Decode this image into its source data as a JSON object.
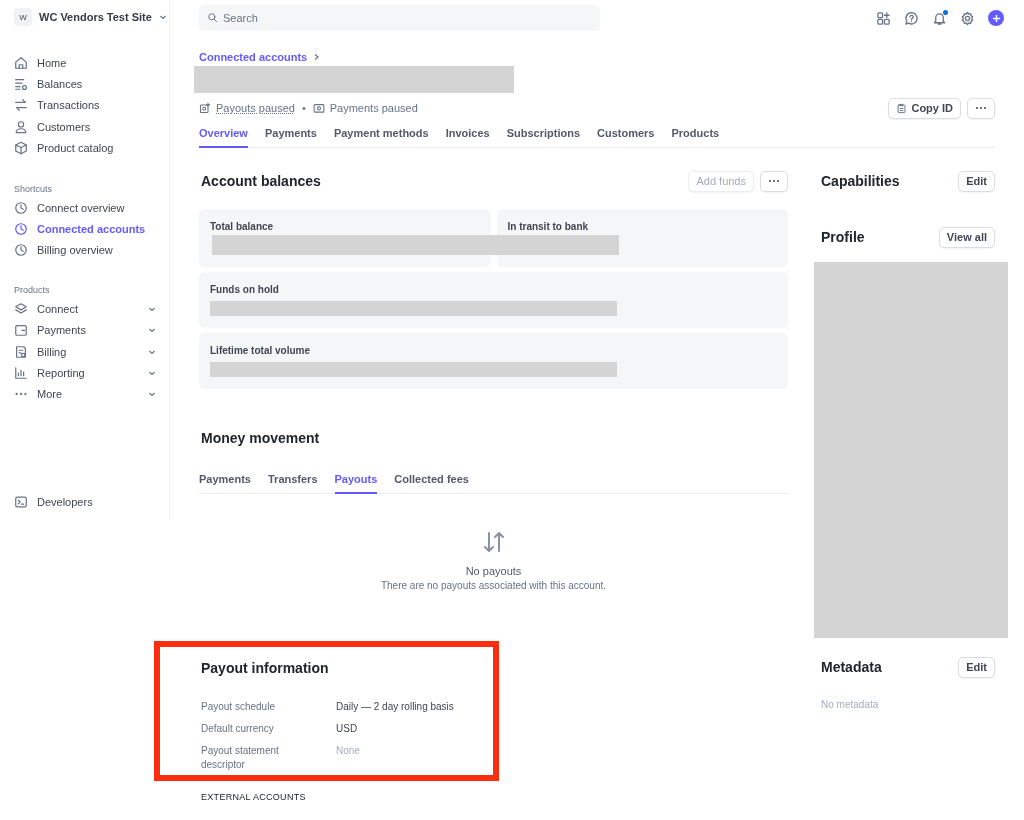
{
  "sidebar": {
    "account": {
      "initial": "W",
      "name": "WC Vendors Test Site"
    },
    "nav": [
      {
        "label": "Home"
      },
      {
        "label": "Balances"
      },
      {
        "label": "Transactions"
      },
      {
        "label": "Customers"
      },
      {
        "label": "Product catalog"
      }
    ],
    "shortcuts": {
      "title": "Shortcuts",
      "items": [
        {
          "label": "Connect overview",
          "selected": false
        },
        {
          "label": "Connected accounts",
          "selected": true
        },
        {
          "label": "Billing overview",
          "selected": false
        }
      ]
    },
    "products": {
      "title": "Products",
      "items": [
        {
          "label": "Connect"
        },
        {
          "label": "Payments"
        },
        {
          "label": "Billing"
        },
        {
          "label": "Reporting"
        },
        {
          "label": "More"
        }
      ]
    },
    "developers": {
      "label": "Developers"
    }
  },
  "search": {
    "placeholder": "Search"
  },
  "notifications": {
    "unread": true
  },
  "breadcrumb": "Connected accounts",
  "status": {
    "payouts": "Payouts paused",
    "separator": "•",
    "payments": "Payments paused"
  },
  "copy_id": "Copy ID",
  "tabs": [
    {
      "label": "Overview",
      "selected": true
    },
    {
      "label": "Payments",
      "selected": false
    },
    {
      "label": "Payment methods",
      "selected": false
    },
    {
      "label": "Invoices",
      "selected": false
    },
    {
      "label": "Subscriptions",
      "selected": false
    },
    {
      "label": "Customers",
      "selected": false
    },
    {
      "label": "Products",
      "selected": false
    }
  ],
  "account_balances": {
    "title": "Account balances",
    "add_funds": {
      "label": "Add funds",
      "disabled": true
    },
    "cards": [
      {
        "label": "Total balance"
      },
      {
        "label": "In transit to bank"
      },
      {
        "label": "Funds on hold"
      },
      {
        "label": "Lifetime total volume"
      }
    ]
  },
  "money_movement": {
    "title": "Money movement",
    "tabs": [
      {
        "label": "Payments",
        "selected": false
      },
      {
        "label": "Transfers",
        "selected": false
      },
      {
        "label": "Payouts",
        "selected": true
      },
      {
        "label": "Collected fees",
        "selected": false
      }
    ],
    "empty": {
      "title": "No payouts",
      "description": "There are no payouts associated with this account."
    }
  },
  "payout_information": {
    "title": "Payout information",
    "rows": [
      {
        "label": "Payout schedule",
        "value": "Daily — 2 day rolling basis",
        "muted": false
      },
      {
        "label": "Default currency",
        "value": "USD",
        "muted": false
      },
      {
        "label": "Payout statement descriptor",
        "value": "None",
        "muted": true
      }
    ]
  },
  "external_accounts": "EXTERNAL ACCOUNTS",
  "capabilities": {
    "title": "Capabilities",
    "button": "Edit"
  },
  "profile": {
    "title": "Profile",
    "button": "View all"
  },
  "metadata": {
    "title": "Metadata",
    "button": "Edit",
    "empty": "No metadata"
  }
}
